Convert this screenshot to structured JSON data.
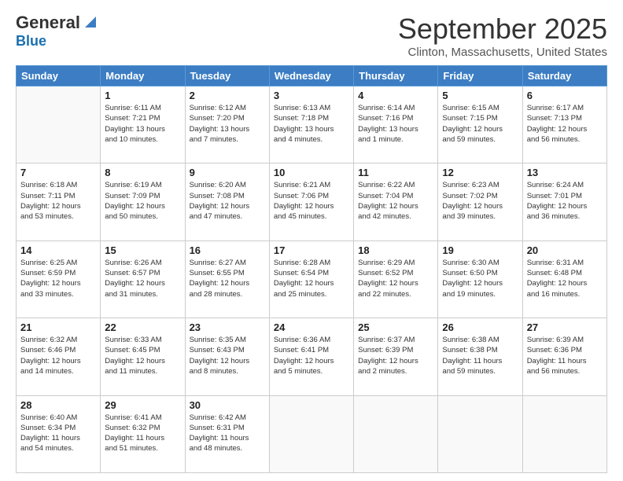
{
  "logo": {
    "text_general": "General",
    "text_blue": "Blue"
  },
  "header": {
    "month": "September 2025",
    "location": "Clinton, Massachusetts, United States"
  },
  "weekdays": [
    "Sunday",
    "Monday",
    "Tuesday",
    "Wednesday",
    "Thursday",
    "Friday",
    "Saturday"
  ],
  "weeks": [
    [
      {
        "day": "",
        "info": ""
      },
      {
        "day": "1",
        "info": "Sunrise: 6:11 AM\nSunset: 7:21 PM\nDaylight: 13 hours\nand 10 minutes."
      },
      {
        "day": "2",
        "info": "Sunrise: 6:12 AM\nSunset: 7:20 PM\nDaylight: 13 hours\nand 7 minutes."
      },
      {
        "day": "3",
        "info": "Sunrise: 6:13 AM\nSunset: 7:18 PM\nDaylight: 13 hours\nand 4 minutes."
      },
      {
        "day": "4",
        "info": "Sunrise: 6:14 AM\nSunset: 7:16 PM\nDaylight: 13 hours\nand 1 minute."
      },
      {
        "day": "5",
        "info": "Sunrise: 6:15 AM\nSunset: 7:15 PM\nDaylight: 12 hours\nand 59 minutes."
      },
      {
        "day": "6",
        "info": "Sunrise: 6:17 AM\nSunset: 7:13 PM\nDaylight: 12 hours\nand 56 minutes."
      }
    ],
    [
      {
        "day": "7",
        "info": "Sunrise: 6:18 AM\nSunset: 7:11 PM\nDaylight: 12 hours\nand 53 minutes."
      },
      {
        "day": "8",
        "info": "Sunrise: 6:19 AM\nSunset: 7:09 PM\nDaylight: 12 hours\nand 50 minutes."
      },
      {
        "day": "9",
        "info": "Sunrise: 6:20 AM\nSunset: 7:08 PM\nDaylight: 12 hours\nand 47 minutes."
      },
      {
        "day": "10",
        "info": "Sunrise: 6:21 AM\nSunset: 7:06 PM\nDaylight: 12 hours\nand 45 minutes."
      },
      {
        "day": "11",
        "info": "Sunrise: 6:22 AM\nSunset: 7:04 PM\nDaylight: 12 hours\nand 42 minutes."
      },
      {
        "day": "12",
        "info": "Sunrise: 6:23 AM\nSunset: 7:02 PM\nDaylight: 12 hours\nand 39 minutes."
      },
      {
        "day": "13",
        "info": "Sunrise: 6:24 AM\nSunset: 7:01 PM\nDaylight: 12 hours\nand 36 minutes."
      }
    ],
    [
      {
        "day": "14",
        "info": "Sunrise: 6:25 AM\nSunset: 6:59 PM\nDaylight: 12 hours\nand 33 minutes."
      },
      {
        "day": "15",
        "info": "Sunrise: 6:26 AM\nSunset: 6:57 PM\nDaylight: 12 hours\nand 31 minutes."
      },
      {
        "day": "16",
        "info": "Sunrise: 6:27 AM\nSunset: 6:55 PM\nDaylight: 12 hours\nand 28 minutes."
      },
      {
        "day": "17",
        "info": "Sunrise: 6:28 AM\nSunset: 6:54 PM\nDaylight: 12 hours\nand 25 minutes."
      },
      {
        "day": "18",
        "info": "Sunrise: 6:29 AM\nSunset: 6:52 PM\nDaylight: 12 hours\nand 22 minutes."
      },
      {
        "day": "19",
        "info": "Sunrise: 6:30 AM\nSunset: 6:50 PM\nDaylight: 12 hours\nand 19 minutes."
      },
      {
        "day": "20",
        "info": "Sunrise: 6:31 AM\nSunset: 6:48 PM\nDaylight: 12 hours\nand 16 minutes."
      }
    ],
    [
      {
        "day": "21",
        "info": "Sunrise: 6:32 AM\nSunset: 6:46 PM\nDaylight: 12 hours\nand 14 minutes."
      },
      {
        "day": "22",
        "info": "Sunrise: 6:33 AM\nSunset: 6:45 PM\nDaylight: 12 hours\nand 11 minutes."
      },
      {
        "day": "23",
        "info": "Sunrise: 6:35 AM\nSunset: 6:43 PM\nDaylight: 12 hours\nand 8 minutes."
      },
      {
        "day": "24",
        "info": "Sunrise: 6:36 AM\nSunset: 6:41 PM\nDaylight: 12 hours\nand 5 minutes."
      },
      {
        "day": "25",
        "info": "Sunrise: 6:37 AM\nSunset: 6:39 PM\nDaylight: 12 hours\nand 2 minutes."
      },
      {
        "day": "26",
        "info": "Sunrise: 6:38 AM\nSunset: 6:38 PM\nDaylight: 11 hours\nand 59 minutes."
      },
      {
        "day": "27",
        "info": "Sunrise: 6:39 AM\nSunset: 6:36 PM\nDaylight: 11 hours\nand 56 minutes."
      }
    ],
    [
      {
        "day": "28",
        "info": "Sunrise: 6:40 AM\nSunset: 6:34 PM\nDaylight: 11 hours\nand 54 minutes."
      },
      {
        "day": "29",
        "info": "Sunrise: 6:41 AM\nSunset: 6:32 PM\nDaylight: 11 hours\nand 51 minutes."
      },
      {
        "day": "30",
        "info": "Sunrise: 6:42 AM\nSunset: 6:31 PM\nDaylight: 11 hours\nand 48 minutes."
      },
      {
        "day": "",
        "info": ""
      },
      {
        "day": "",
        "info": ""
      },
      {
        "day": "",
        "info": ""
      },
      {
        "day": "",
        "info": ""
      }
    ]
  ]
}
